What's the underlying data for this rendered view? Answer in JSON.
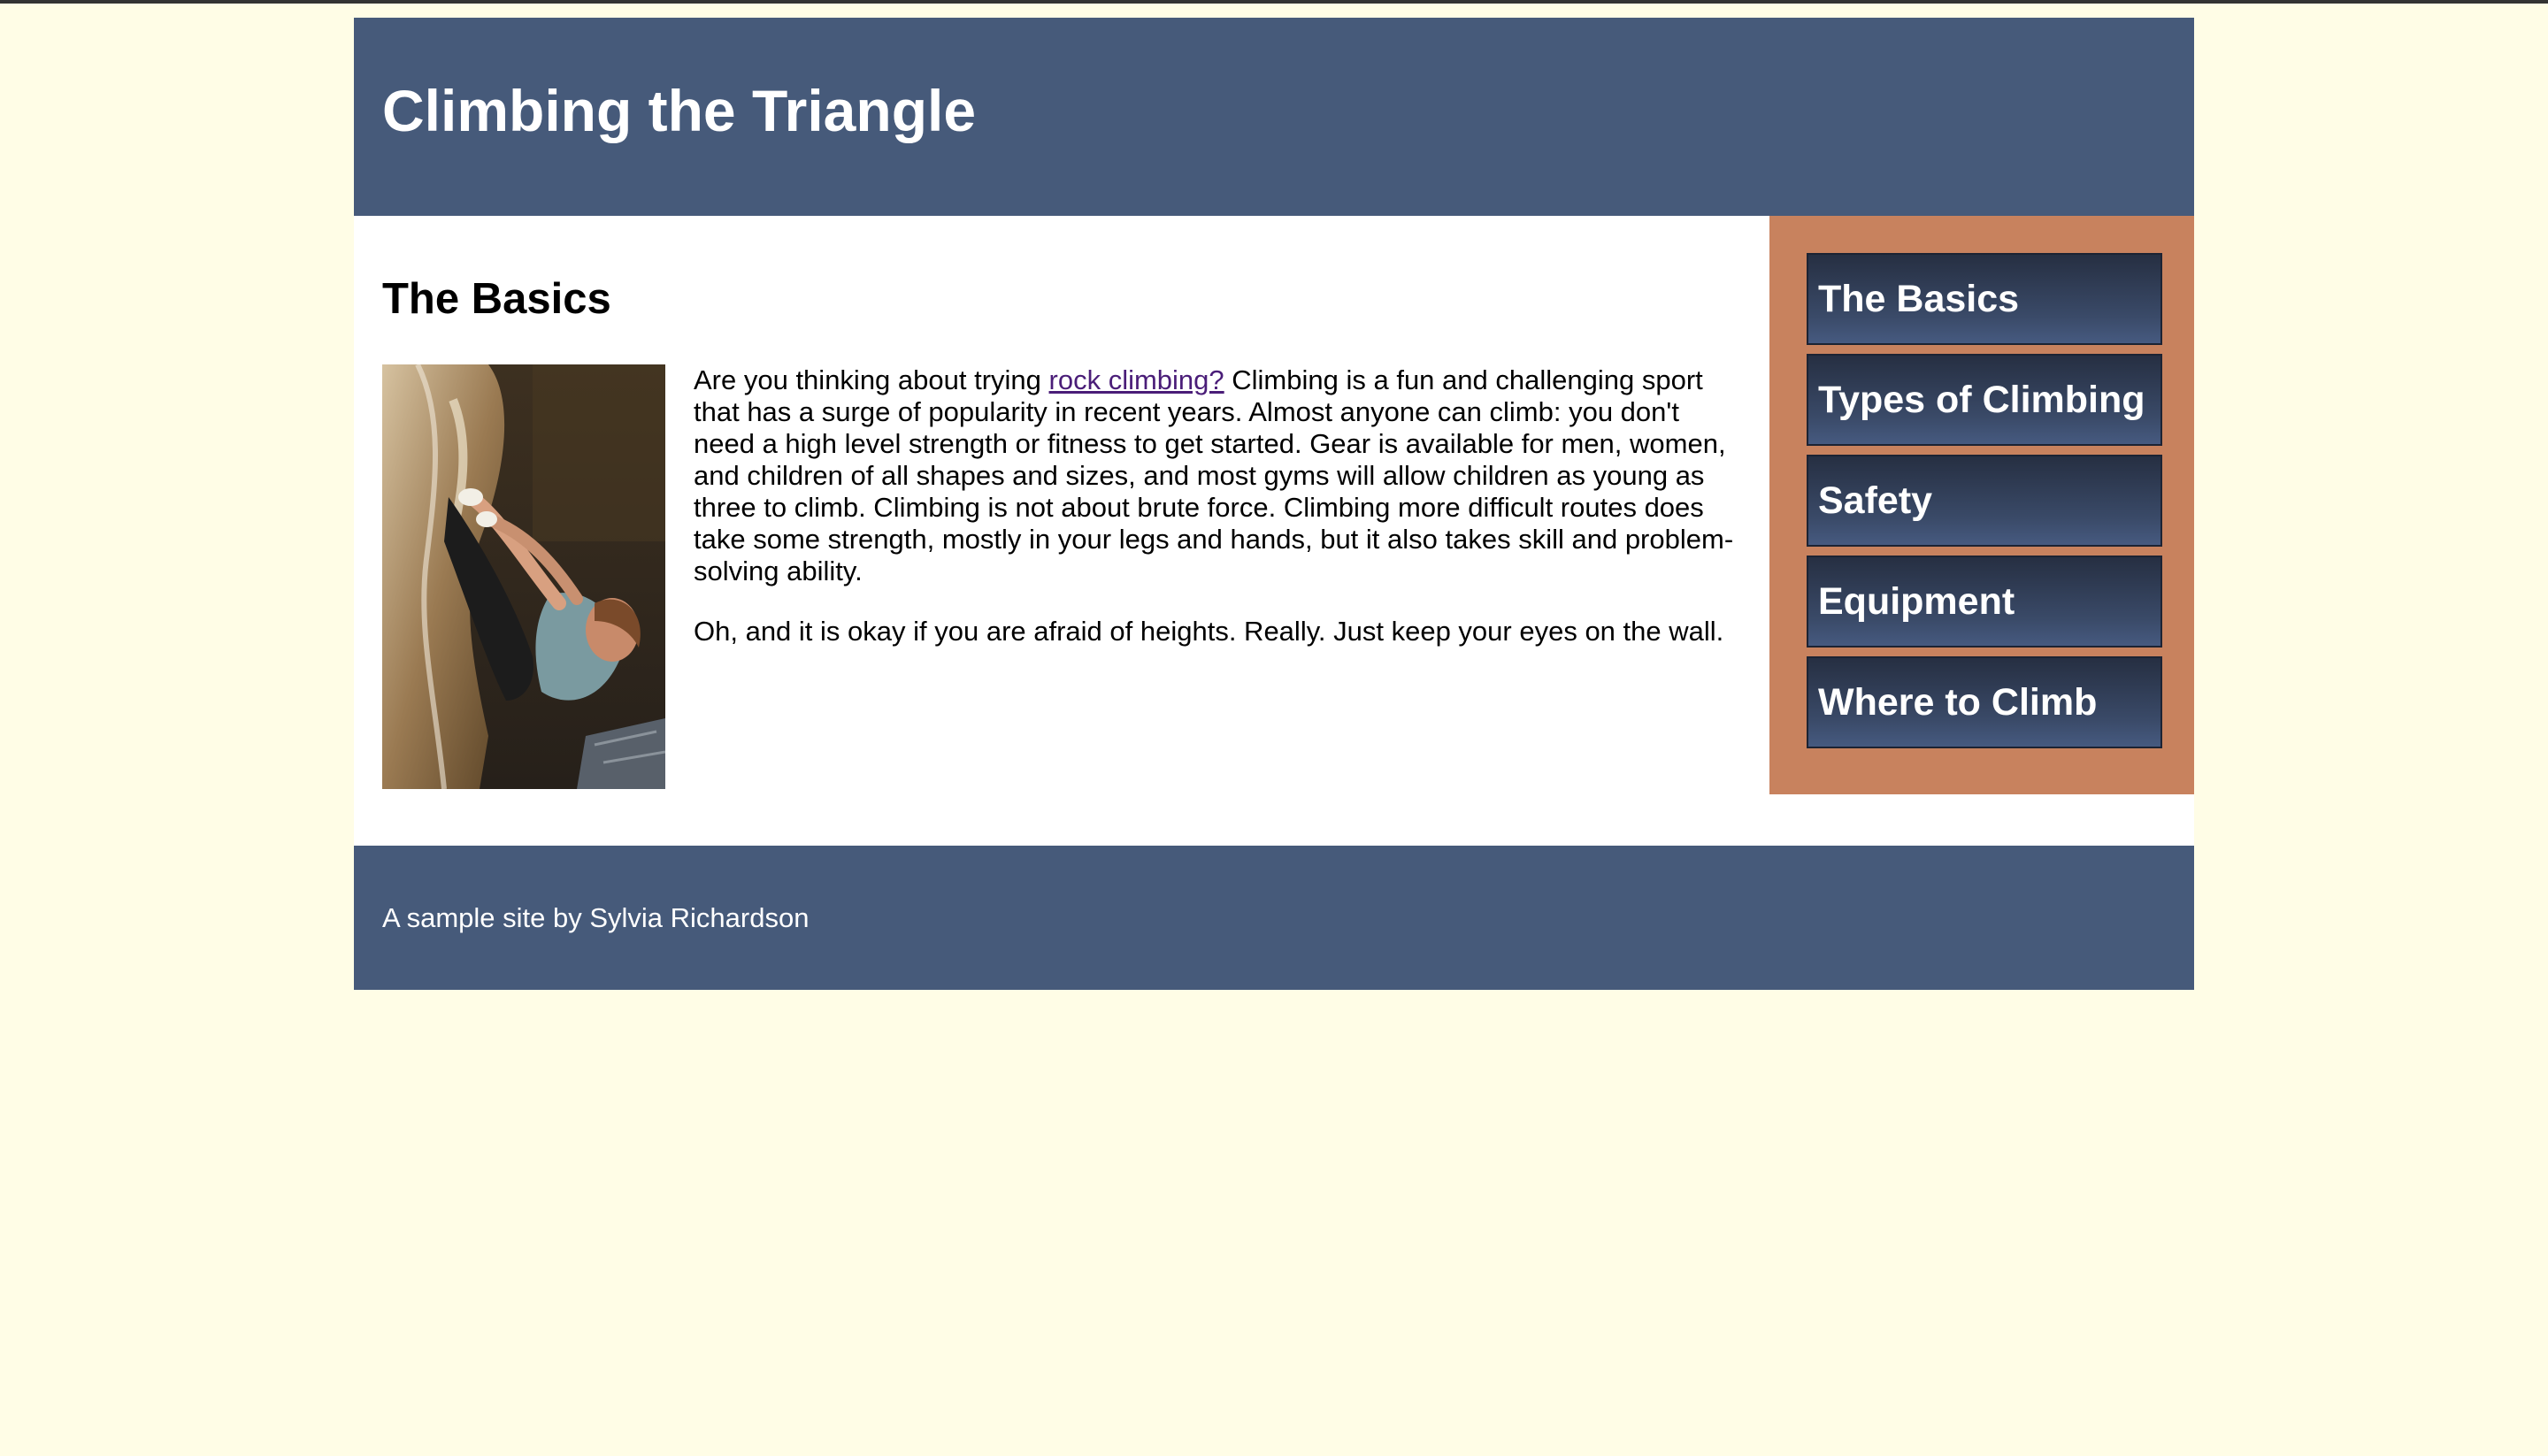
{
  "header": {
    "title": "Climbing the Triangle"
  },
  "main": {
    "heading": "The Basics",
    "image_alt": "Woman rock climbing",
    "paragraph1": {
      "before_link": "Are you thinking about trying ",
      "link": "rock climbing?",
      "after_link": " Climbing is a fun and challenging sport that has a surge of popularity in recent years. Almost anyone can climb: you don't need a high level strength or fitness to get started. Gear is available for men, women, and children of all shapes and sizes, and most gyms will allow children as young as three to climb. Climbing is not about brute force. Climbing more difficult routes does take some strength, mostly in your legs and hands, but it also takes skill and problem-solving ability."
    },
    "paragraph2": "Oh, and it is okay if you are afraid of heights. Really. Just keep your eyes on the wall."
  },
  "sidebar": {
    "items": [
      {
        "label": "The Basics"
      },
      {
        "label": "Types of Climbing"
      },
      {
        "label": "Safety"
      },
      {
        "label": "Equipment"
      },
      {
        "label": "Where to Climb"
      }
    ]
  },
  "footer": {
    "text": "A sample site by Sylvia Richardson"
  },
  "colors": {
    "background": "#fffde6",
    "header_footer": "#465a7a",
    "sidebar": "#c8825e",
    "nav_button": "#2e3a52",
    "link": "#4a1d78"
  }
}
